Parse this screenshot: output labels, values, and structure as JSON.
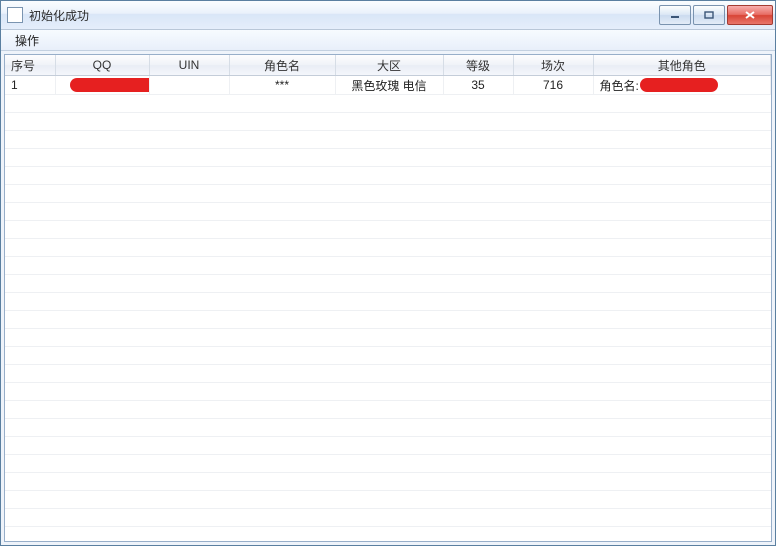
{
  "window": {
    "title": "初始化成功"
  },
  "menu": {
    "operation": "操作"
  },
  "table": {
    "headers": {
      "seq": "序号",
      "qq": "QQ",
      "uin": "UIN",
      "role_name": "角色名",
      "zone": "大区",
      "level": "等级",
      "matches": "场次",
      "other_roles": "其他角色"
    },
    "rows": [
      {
        "seq": "1",
        "qq": "",
        "uin": "",
        "role_name": "***",
        "zone": "黑色玫瑰  电信",
        "level": "35",
        "matches": "716",
        "other_roles_prefix": "角色名:",
        "other_roles_value": ""
      }
    ]
  }
}
